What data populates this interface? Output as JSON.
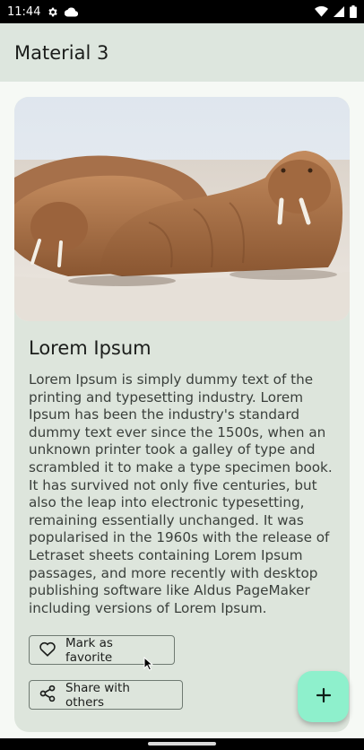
{
  "status_bar": {
    "time": "11:44",
    "left_icons": [
      "gear-icon",
      "cloud-icon"
    ],
    "right_icons": [
      "wifi-icon",
      "signal-icon",
      "battery-icon"
    ]
  },
  "app_bar": {
    "title": "Material 3"
  },
  "card": {
    "image_alt": "walrus-photo",
    "title": "Lorem Ipsum",
    "body": "Lorem Ipsum is simply dummy text of the printing and typesetting industry. Lorem Ipsum has been the industry's standard dummy text ever since the 1500s, when an unknown printer took a galley of type and scrambled it to make a type specimen book. It has survived not only five centuries, but also the leap into electronic typesetting, remaining essentially unchanged. It was popularised in the 1960s with the release of Letraset sheets containing Lorem Ipsum passages, and more recently with desktop publishing software like Aldus PageMaker including versions of Lorem Ipsum.",
    "favorite_label": "Mark as favorite",
    "share_label": "Share with others"
  },
  "fab": {
    "icon": "plus-icon"
  },
  "colors": {
    "app_bar": "#dde6de",
    "card": "#dde5dc",
    "fab": "#8ef0cc",
    "background": "#f6f9f5"
  }
}
